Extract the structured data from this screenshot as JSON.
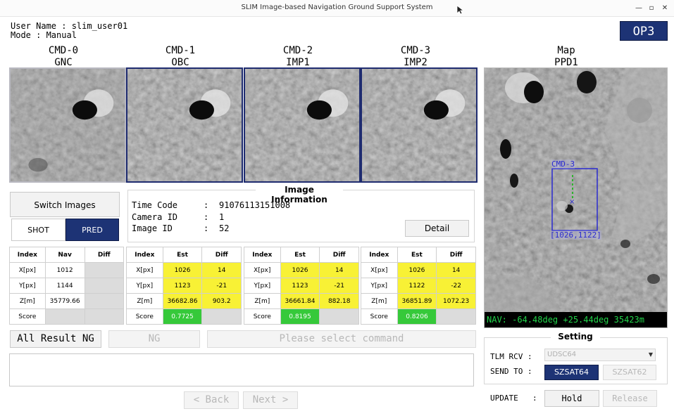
{
  "window": {
    "title": "SLIM Image-based Navigation Ground Support System"
  },
  "user": {
    "name_line": "User Name : slim_user01",
    "mode_line": "Mode : Manual"
  },
  "badge": "OP3",
  "columns": [
    {
      "line1": "CMD-0",
      "line2": "GNC"
    },
    {
      "line1": "CMD-1",
      "line2": "OBC"
    },
    {
      "line1": "CMD-2",
      "line2": "IMP1"
    },
    {
      "line1": "CMD-3",
      "line2": "IMP2"
    },
    {
      "line1": "Map",
      "line2": "PPD1"
    }
  ],
  "map": {
    "nav_text": "NAV: -64.48deg +25.44deg  35423m",
    "box_label_top": "CMD-3",
    "box_label_bottom": "[1026,1122]"
  },
  "switch": {
    "title": "Switch Images",
    "shot": "SHOT",
    "pred": "PRED",
    "active": "pred"
  },
  "image_info": {
    "title": "Image Information",
    "rows": [
      {
        "label": "Time Code",
        "sep": ":",
        "value": "91076113151008"
      },
      {
        "label": "Camera ID",
        "sep": ":",
        "value": "1"
      },
      {
        "label": "Image ID",
        "sep": ":",
        "value": "52"
      }
    ],
    "detail_button": "Detail"
  },
  "nav_table": {
    "headers": [
      "Index",
      "Nav",
      "Diff"
    ],
    "rows": [
      [
        "X[px]",
        "1012",
        ""
      ],
      [
        "Y[px]",
        "1144",
        ""
      ],
      [
        "Z[m]",
        "35779.66",
        ""
      ],
      [
        "Score",
        "",
        ""
      ]
    ]
  },
  "est_tables": [
    {
      "headers": [
        "Index",
        "Est",
        "Diff"
      ],
      "rows": [
        [
          "X[px]",
          "1026",
          "14"
        ],
        [
          "Y[px]",
          "1123",
          "-21"
        ],
        [
          "Z[m]",
          "36682.86",
          "903.2"
        ],
        [
          "Score",
          "0.7725",
          ""
        ]
      ]
    },
    {
      "headers": [
        "Index",
        "Est",
        "Diff"
      ],
      "rows": [
        [
          "X[px]",
          "1026",
          "14"
        ],
        [
          "Y[px]",
          "1123",
          "-21"
        ],
        [
          "Z[m]",
          "36661.84",
          "882.18"
        ],
        [
          "Score",
          "0.8195",
          ""
        ]
      ]
    },
    {
      "headers": [
        "Index",
        "Est",
        "Diff"
      ],
      "rows": [
        [
          "X[px]",
          "1026",
          "14"
        ],
        [
          "Y[px]",
          "1122",
          "-22"
        ],
        [
          "Z[m]",
          "36851.89",
          "1072.23"
        ],
        [
          "Score",
          "0.8206",
          ""
        ]
      ]
    }
  ],
  "actions": {
    "all_result_ng": "All Result NG",
    "ng": "NG",
    "command_prompt": "Please select command"
  },
  "nav_buttons": {
    "back": "< Back",
    "next": "Next >"
  },
  "setting": {
    "title": "Setting",
    "tlm_rcv_label": "TLM RCV :",
    "tlm_rcv_value": "UDSC64",
    "send_to_label": "SEND TO :",
    "send_to_options": [
      "SZSAT64",
      "SZSAT62"
    ],
    "send_to_active": "SZSAT64",
    "update_label": "UPDATE",
    "update_sep": ":",
    "hold": "Hold",
    "release": "Release"
  },
  "colors": {
    "accent": "#1d3375",
    "highlight": "#f8f135",
    "score_ok": "#36c93a",
    "nav_text": "#21d54a"
  }
}
